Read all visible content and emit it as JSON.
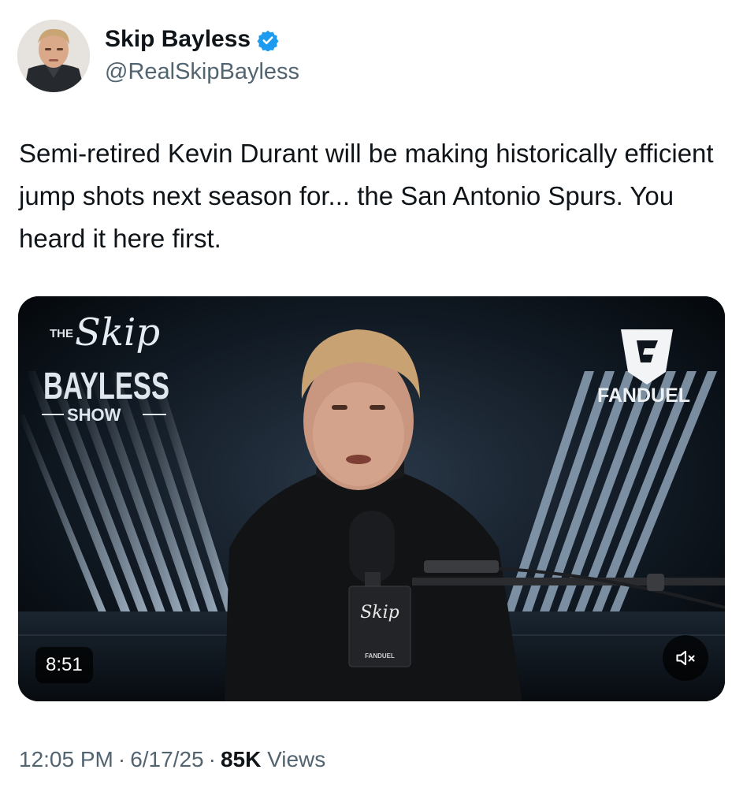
{
  "author": {
    "name": "Skip Bayless",
    "handle": "@RealSkipBayless",
    "verified": true,
    "verified_color": "#1d9bf0"
  },
  "tweet": {
    "text": "Semi-retired Kevin Durant will be making historically efficient jump shots next season for... the San Antonio Spurs. You heard it here first."
  },
  "media": {
    "type": "video",
    "duration": "8:51",
    "muted": true,
    "show_logo": {
      "the": "THE",
      "skip": "Skip",
      "bayless": "BAYLESS",
      "show": "SHOW"
    },
    "sponsor": "FANDUEL",
    "mic_flag_text": "Skip",
    "mic_flag_sponsor": "FANDUEL"
  },
  "meta": {
    "time": "12:05 PM",
    "date": "6/17/25",
    "views_count": "85K",
    "views_label": "Views"
  }
}
